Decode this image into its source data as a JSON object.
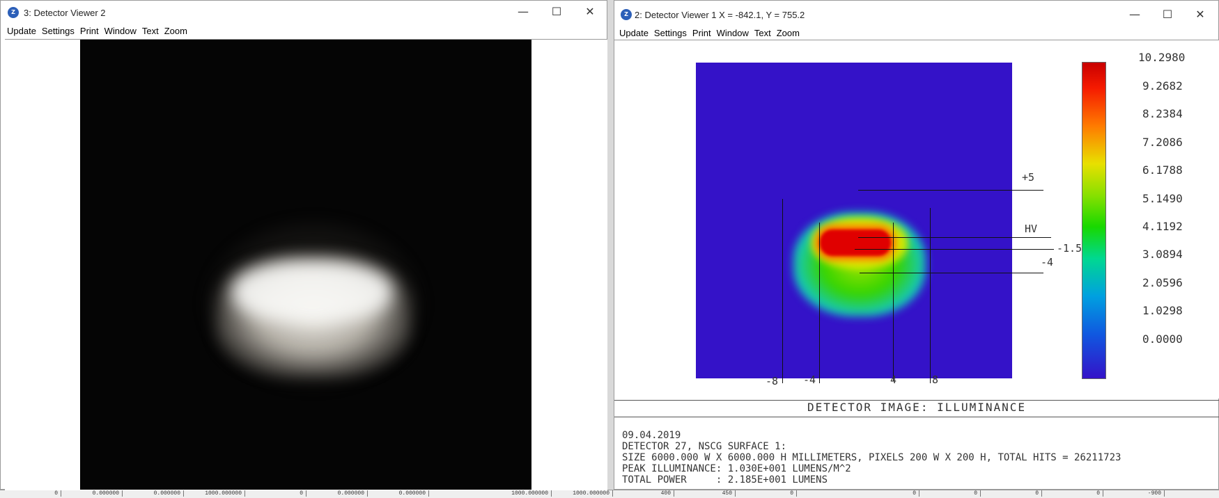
{
  "bottom_strip": [
    "0",
    "0.000000",
    "0.000000",
    "1000.000000",
    "0",
    "0.000000",
    "0.000000",
    "",
    "1000.000000",
    "1000.000000",
    "400",
    "450",
    "0",
    "",
    "0",
    "0",
    "0",
    "0",
    "-900"
  ],
  "left_window": {
    "title": "3: Detector Viewer 2",
    "menu": [
      "Update",
      "Settings",
      "Print",
      "Window",
      "Text",
      "Zoom"
    ]
  },
  "right_window": {
    "title": "2: Detector Viewer 1 X = -842.1, Y = 755.2",
    "menu": [
      "Update",
      "Settings",
      "Print",
      "Window",
      "Text",
      "Zoom"
    ],
    "colorbar_ticks": [
      "10.2980",
      "9.2682",
      "8.2384",
      "7.2086",
      "6.1788",
      "5.1490",
      "4.1192",
      "3.0894",
      "2.0596",
      "1.0298",
      "0.0000"
    ],
    "annotations": {
      "plus5": "+5",
      "hv": "HV",
      "minus1_5": "-1.5",
      "minus4": "-4"
    },
    "x_labels": [
      "-8",
      "-4",
      "4",
      "8"
    ],
    "plot_title": "DETECTOR IMAGE: ILLUMINANCE",
    "info_lines": [
      "09.04.2019",
      "DETECTOR 27, NSCG SURFACE 1:",
      "SIZE 6000.000 W X 6000.000 H MILLIMETERS, PIXELS 200 W X 200 H, TOTAL HITS = 26211723",
      "PEAK ILLUMINANCE: 1.030E+001 LUMENS/M^2",
      "TOTAL POWER     : 2.185E+001 LUMENS"
    ]
  },
  "window_controls": {
    "minimize": "—",
    "maximize": "☐",
    "close": "✕"
  },
  "colors": {
    "heatmap_background": "#3412c8",
    "peak": "#e00000"
  }
}
